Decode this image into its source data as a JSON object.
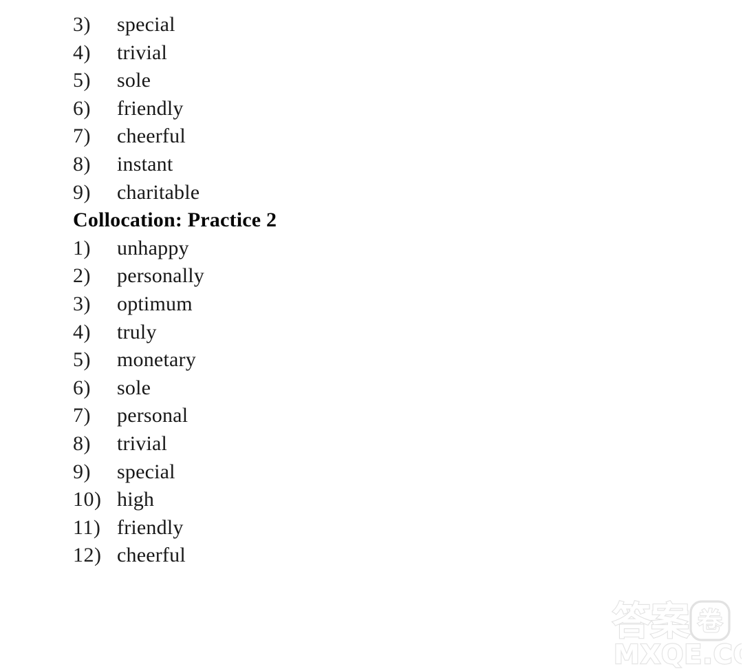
{
  "document": {
    "type": "answer-key-page",
    "background_color": "#ffffff",
    "text_color": "#181818"
  },
  "blocks": [
    {
      "kind": "answer",
      "number": "3)",
      "word": "special"
    },
    {
      "kind": "answer",
      "number": "4)",
      "word": "trivial"
    },
    {
      "kind": "answer",
      "number": "5)",
      "word": "sole"
    },
    {
      "kind": "answer",
      "number": "6)",
      "word": "friendly"
    },
    {
      "kind": "answer",
      "number": "7)",
      "word": "cheerful"
    },
    {
      "kind": "answer",
      "number": "8)",
      "word": "instant"
    },
    {
      "kind": "answer",
      "number": "9)",
      "word": "charitable"
    },
    {
      "kind": "heading",
      "text": "Collocation: Practice 2"
    },
    {
      "kind": "answer",
      "number": "1)",
      "word": "unhappy"
    },
    {
      "kind": "answer",
      "number": "2)",
      "word": "personally"
    },
    {
      "kind": "answer",
      "number": "3)",
      "word": "optimum"
    },
    {
      "kind": "answer",
      "number": "4)",
      "word": "truly"
    },
    {
      "kind": "answer",
      "number": "5)",
      "word": "monetary"
    },
    {
      "kind": "answer",
      "number": "6)",
      "word": "sole"
    },
    {
      "kind": "answer",
      "number": "7)",
      "word": "personal"
    },
    {
      "kind": "answer",
      "number": "8)",
      "word": "trivial"
    },
    {
      "kind": "answer",
      "number": "9)",
      "word": "special"
    },
    {
      "kind": "answer",
      "number": "10)",
      "word": "high"
    },
    {
      "kind": "answer",
      "number": "11)",
      "word": "friendly"
    },
    {
      "kind": "answer",
      "number": "12)",
      "word": "cheerful"
    }
  ],
  "watermark": {
    "cjk_text": "答案",
    "cjk_badge_char": "卷",
    "domain_text": "MXQE.COM",
    "color": "#e2e2e2"
  }
}
